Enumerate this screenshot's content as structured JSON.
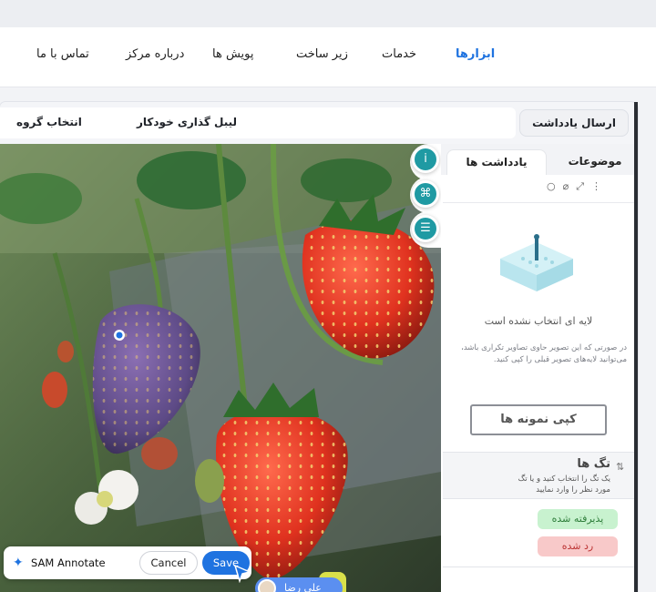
{
  "nav": {
    "items": [
      {
        "label": "ابزارها",
        "active": true
      },
      {
        "label": "خدمات"
      },
      {
        "label": "زیر ساخت"
      },
      {
        "label": "پویش ها"
      },
      {
        "label": "درباره مرکز"
      },
      {
        "label": "تماس با ما"
      }
    ]
  },
  "toolbar": {
    "group_label": "انتخاب گروه",
    "auto_label": "لیبل گذاری خودکار",
    "send_label": "ارسال یادداشت"
  },
  "side_buttons": {
    "info_icon": "info-icon",
    "command_icon": "command-icon",
    "sliders_icon": "sliders-icon"
  },
  "panel": {
    "tab_topics": "موضوعات",
    "tab_notes": "یادداشت ها",
    "empty_title": "لایه ای انتخاب نشده است",
    "empty_desc": "در صورتی که این تصویر حاوی تصاویر تکراری باشد، می‌توانید لایه‌های تصویر قبلی را کپی کنید.",
    "copy_button": "کپی نمونه ها",
    "tags_title": "تگ ها",
    "tags_desc": "یک تگ را انتخاب کنید و یا تگ مورد نظر را وارد نمایید",
    "accepted": "پذیرفته شده",
    "rejected": "رد شده"
  },
  "sam": {
    "label": "SAM Annotate",
    "cancel": "Cancel",
    "save": "Save"
  },
  "user": {
    "name": "علی رضا"
  },
  "colors": {
    "accent": "#1f73e0",
    "teal": "#1f9aa3",
    "accepted_bg": "#c8f2cf",
    "rejected_bg": "#f8c9c9"
  }
}
